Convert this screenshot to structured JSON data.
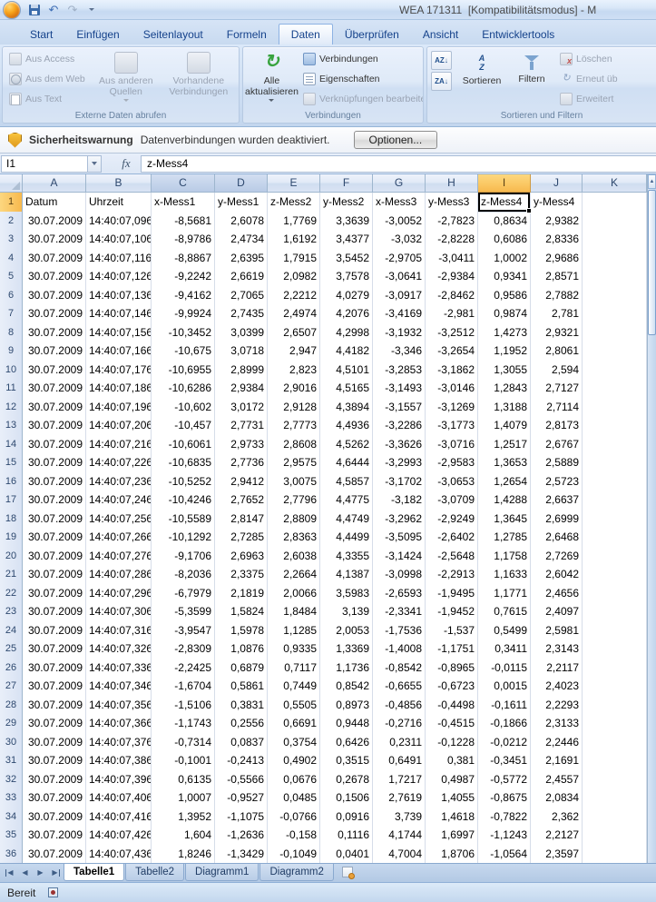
{
  "window": {
    "title": "WEA 171311  [Kompatibilitätsmodus] - M"
  },
  "ribbon": {
    "tabs": [
      "Start",
      "Einfügen",
      "Seitenlayout",
      "Formeln",
      "Daten",
      "Überprüfen",
      "Ansicht",
      "Entwicklertools"
    ],
    "active_tab": "Daten",
    "groups": {
      "extern": {
        "label": "Externe Daten abrufen",
        "aus_access": "Aus Access",
        "aus_dem_web": "Aus dem Web",
        "aus_text": "Aus Text",
        "aus_anderen_quellen": "Aus anderen Quellen",
        "vorhandene_verbindungen": "Vorhandene Verbindungen"
      },
      "verbindungen": {
        "label": "Verbindungen",
        "alle_aktualisieren": "Alle aktualisieren",
        "verbindungen": "Verbindungen",
        "eigenschaften": "Eigenschaften",
        "verknuepfungen": "Verknüpfungen bearbeiten"
      },
      "sortieren": {
        "label": "Sortieren und Filtern",
        "sortieren": "Sortieren",
        "filtern": "Filtern",
        "loeschen": "Löschen",
        "erneut": "Erneut üb",
        "erweitert": "Erweitert"
      }
    }
  },
  "security_bar": {
    "title": "Sicherheitswarnung",
    "message": "Datenverbindungen wurden deaktiviert.",
    "button_label": "Optionen..."
  },
  "formula_bar": {
    "name_box": "I1",
    "formula": "z-Mess4"
  },
  "grid": {
    "columns": [
      "A",
      "B",
      "C",
      "D",
      "E",
      "F",
      "G",
      "H",
      "I",
      "J",
      "K"
    ],
    "selected_cell": "I1",
    "selected_column": "I",
    "selected_row": 1,
    "first_data_row": 2,
    "header_row": [
      "Datum",
      "Uhrzeit",
      "x-Mess1",
      "y-Mess1",
      "z-Mess2",
      "y-Mess2",
      "x-Mess3",
      "y-Mess3",
      "z-Mess4",
      "y-Mess4",
      ""
    ],
    "rows": [
      [
        "30.07.2009",
        "14:40:07,096",
        "-8,5681",
        "2,6078",
        "1,7769",
        "3,3639",
        "-3,0052",
        "-2,7823",
        "0,8634",
        "2,9382"
      ],
      [
        "30.07.2009",
        "14:40:07,106",
        "-8,9786",
        "2,4734",
        "1,6192",
        "3,4377",
        "-3,032",
        "-2,8228",
        "0,6086",
        "2,8336"
      ],
      [
        "30.07.2009",
        "14:40:07,116",
        "-8,8867",
        "2,6395",
        "1,7915",
        "3,5452",
        "-2,9705",
        "-3,0411",
        "1,0002",
        "2,9686"
      ],
      [
        "30.07.2009",
        "14:40:07,126",
        "-9,2242",
        "2,6619",
        "2,0982",
        "3,7578",
        "-3,0641",
        "-2,9384",
        "0,9341",
        "2,8571"
      ],
      [
        "30.07.2009",
        "14:40:07,136",
        "-9,4162",
        "2,7065",
        "2,2212",
        "4,0279",
        "-3,0917",
        "-2,8462",
        "0,9586",
        "2,7882"
      ],
      [
        "30.07.2009",
        "14:40:07,146",
        "-9,9924",
        "2,7435",
        "2,4974",
        "4,2076",
        "-3,4169",
        "-2,981",
        "0,9874",
        "2,781"
      ],
      [
        "30.07.2009",
        "14:40:07,156",
        "-10,3452",
        "3,0399",
        "2,6507",
        "4,2998",
        "-3,1932",
        "-3,2512",
        "1,4273",
        "2,9321"
      ],
      [
        "30.07.2009",
        "14:40:07,166",
        "-10,675",
        "3,0718",
        "2,947",
        "4,4182",
        "-3,346",
        "-3,2654",
        "1,1952",
        "2,8061"
      ],
      [
        "30.07.2009",
        "14:40:07,176",
        "-10,6955",
        "2,8999",
        "2,823",
        "4,5101",
        "-3,2853",
        "-3,1862",
        "1,3055",
        "2,594"
      ],
      [
        "30.07.2009",
        "14:40:07,186",
        "-10,6286",
        "2,9384",
        "2,9016",
        "4,5165",
        "-3,1493",
        "-3,0146",
        "1,2843",
        "2,7127"
      ],
      [
        "30.07.2009",
        "14:40:07,196",
        "-10,602",
        "3,0172",
        "2,9128",
        "4,3894",
        "-3,1557",
        "-3,1269",
        "1,3188",
        "2,7114"
      ],
      [
        "30.07.2009",
        "14:40:07,206",
        "-10,457",
        "2,7731",
        "2,7773",
        "4,4936",
        "-3,2286",
        "-3,1773",
        "1,4079",
        "2,8173"
      ],
      [
        "30.07.2009",
        "14:40:07,216",
        "-10,6061",
        "2,9733",
        "2,8608",
        "4,5262",
        "-3,3626",
        "-3,0716",
        "1,2517",
        "2,6767"
      ],
      [
        "30.07.2009",
        "14:40:07,226",
        "-10,6835",
        "2,7736",
        "2,9575",
        "4,6444",
        "-3,2993",
        "-2,9583",
        "1,3653",
        "2,5889"
      ],
      [
        "30.07.2009",
        "14:40:07,236",
        "-10,5252",
        "2,9412",
        "3,0075",
        "4,5857",
        "-3,1702",
        "-3,0653",
        "1,2654",
        "2,5723"
      ],
      [
        "30.07.2009",
        "14:40:07,246",
        "-10,4246",
        "2,7652",
        "2,7796",
        "4,4775",
        "-3,182",
        "-3,0709",
        "1,4288",
        "2,6637"
      ],
      [
        "30.07.2009",
        "14:40:07,256",
        "-10,5589",
        "2,8147",
        "2,8809",
        "4,4749",
        "-3,2962",
        "-2,9249",
        "1,3645",
        "2,6999"
      ],
      [
        "30.07.2009",
        "14:40:07,266",
        "-10,1292",
        "2,7285",
        "2,8363",
        "4,4499",
        "-3,5095",
        "-2,6402",
        "1,2785",
        "2,6468"
      ],
      [
        "30.07.2009",
        "14:40:07,276",
        "-9,1706",
        "2,6963",
        "2,6038",
        "4,3355",
        "-3,1424",
        "-2,5648",
        "1,1758",
        "2,7269"
      ],
      [
        "30.07.2009",
        "14:40:07,286",
        "-8,2036",
        "2,3375",
        "2,2664",
        "4,1387",
        "-3,0998",
        "-2,2913",
        "1,1633",
        "2,6042"
      ],
      [
        "30.07.2009",
        "14:40:07,296",
        "-6,7979",
        "2,1819",
        "2,0066",
        "3,5983",
        "-2,6593",
        "-1,9495",
        "1,1771",
        "2,4656"
      ],
      [
        "30.07.2009",
        "14:40:07,306",
        "-5,3599",
        "1,5824",
        "1,8484",
        "3,139",
        "-2,3341",
        "-1,9452",
        "0,7615",
        "2,4097"
      ],
      [
        "30.07.2009",
        "14:40:07,316",
        "-3,9547",
        "1,5978",
        "1,1285",
        "2,0053",
        "-1,7536",
        "-1,537",
        "0,5499",
        "2,5981"
      ],
      [
        "30.07.2009",
        "14:40:07,326",
        "-2,8309",
        "1,0876",
        "0,9335",
        "1,3369",
        "-1,4008",
        "-1,1751",
        "0,3411",
        "2,3143"
      ],
      [
        "30.07.2009",
        "14:40:07,336",
        "-2,2425",
        "0,6879",
        "0,7117",
        "1,1736",
        "-0,8542",
        "-0,8965",
        "-0,0115",
        "2,2117"
      ],
      [
        "30.07.2009",
        "14:40:07,346",
        "-1,6704",
        "0,5861",
        "0,7449",
        "0,8542",
        "-0,6655",
        "-0,6723",
        "0,0015",
        "2,4023"
      ],
      [
        "30.07.2009",
        "14:40:07,356",
        "-1,5106",
        "0,3831",
        "0,5505",
        "0,8973",
        "-0,4856",
        "-0,4498",
        "-0,1611",
        "2,2293"
      ],
      [
        "30.07.2009",
        "14:40:07,366",
        "-1,1743",
        "0,2556",
        "0,6691",
        "0,9448",
        "-0,2716",
        "-0,4515",
        "-0,1866",
        "2,3133"
      ],
      [
        "30.07.2009",
        "14:40:07,376",
        "-0,7314",
        "0,0837",
        "0,3754",
        "0,6426",
        "0,2311",
        "-0,1228",
        "-0,0212",
        "2,2446"
      ],
      [
        "30.07.2009",
        "14:40:07,386",
        "-0,1001",
        "-0,2413",
        "0,4902",
        "0,3515",
        "0,6491",
        "0,381",
        "-0,3451",
        "2,1691"
      ],
      [
        "30.07.2009",
        "14:40:07,396",
        "0,6135",
        "-0,5566",
        "0,0676",
        "0,2678",
        "1,7217",
        "0,4987",
        "-0,5772",
        "2,4557"
      ],
      [
        "30.07.2009",
        "14:40:07,406",
        "1,0007",
        "-0,9527",
        "0,0485",
        "0,1506",
        "2,7619",
        "1,4055",
        "-0,8675",
        "2,0834"
      ],
      [
        "30.07.2009",
        "14:40:07,416",
        "1,3952",
        "-1,1075",
        "-0,0766",
        "0,0916",
        "3,739",
        "1,4618",
        "-0,7822",
        "2,362"
      ],
      [
        "30.07.2009",
        "14:40:07,426",
        "1,604",
        "-1,2636",
        "-0,158",
        "0,1116",
        "4,1744",
        "1,6997",
        "-1,1243",
        "2,2127"
      ],
      [
        "30.07.2009",
        "14:40:07,436",
        "1,8246",
        "-1,3429",
        "-0,1049",
        "0,0401",
        "4,7004",
        "1,8706",
        "-1,0564",
        "2,3597"
      ]
    ]
  },
  "sheet_tabs": {
    "tabs": [
      "Tabelle1",
      "Tabelle2",
      "Diagramm1",
      "Diagramm2"
    ],
    "active": "Tabelle1"
  },
  "status_bar": {
    "label": "Bereit"
  }
}
